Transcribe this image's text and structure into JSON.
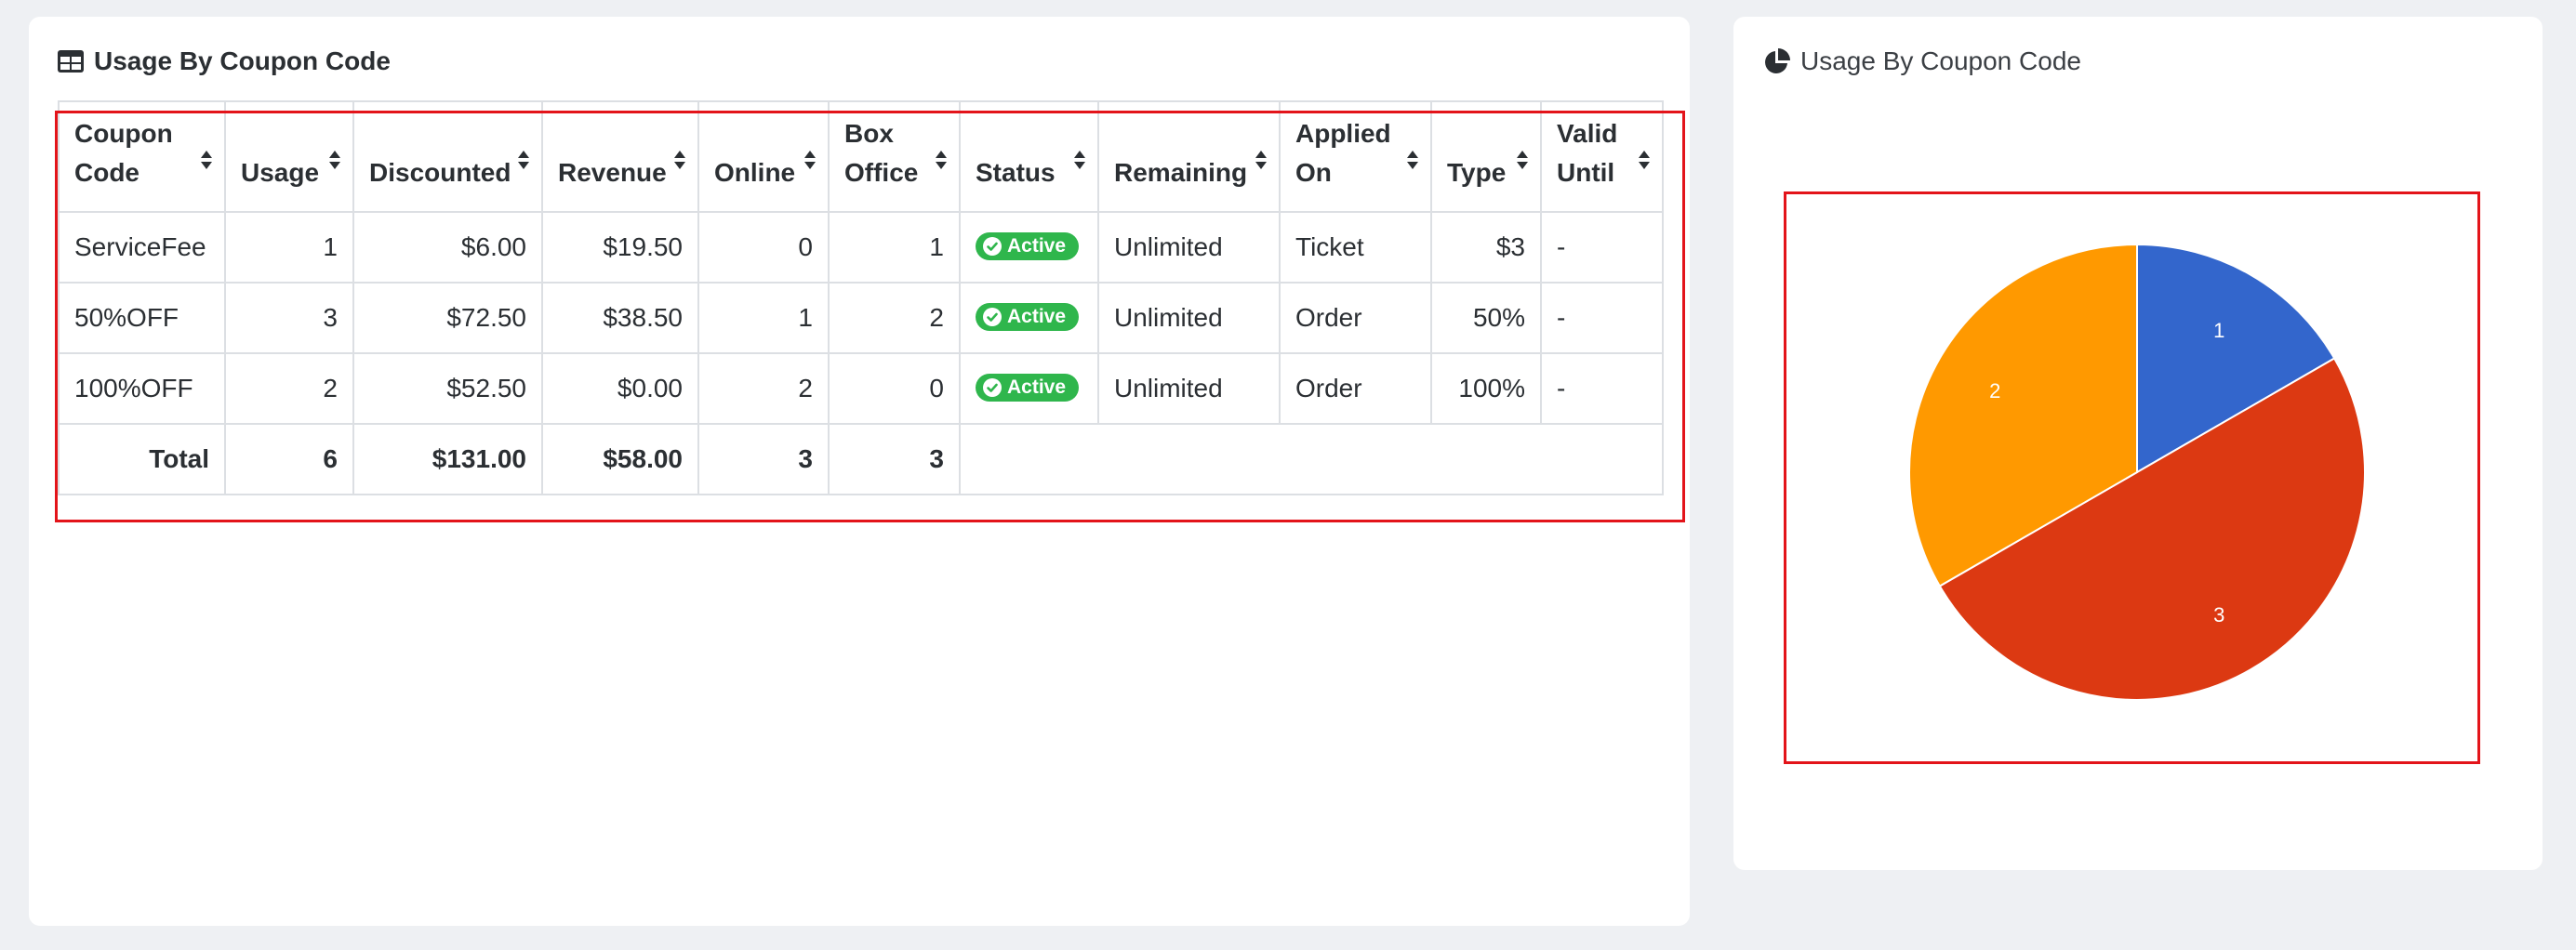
{
  "table_card": {
    "title": "Usage By Coupon Code",
    "icon": "table-icon",
    "columns": [
      "Coupon Code",
      "Usage",
      "Discounted",
      "Revenue",
      "Online",
      "Box Office",
      "Status",
      "Remaining",
      "Applied On",
      "Type",
      "Valid Until"
    ],
    "rows": [
      {
        "code": "ServiceFee",
        "usage": "1",
        "discounted": "$6.00",
        "revenue": "$19.50",
        "online": "0",
        "box_office": "1",
        "status": "Active",
        "remaining": "Unlimited",
        "applied_on": "Ticket",
        "type": "$3",
        "valid_until": "-"
      },
      {
        "code": "50%OFF",
        "usage": "3",
        "discounted": "$72.50",
        "revenue": "$38.50",
        "online": "1",
        "box_office": "2",
        "status": "Active",
        "remaining": "Unlimited",
        "applied_on": "Order",
        "type": "50%",
        "valid_until": "-"
      },
      {
        "code": "100%OFF",
        "usage": "2",
        "discounted": "$52.50",
        "revenue": "$0.00",
        "online": "2",
        "box_office": "0",
        "status": "Active",
        "remaining": "Unlimited",
        "applied_on": "Order",
        "type": "100%",
        "valid_until": "-"
      }
    ],
    "totals": {
      "label": "Total",
      "usage": "6",
      "discounted": "$131.00",
      "revenue": "$58.00",
      "online": "3",
      "box_office": "3"
    }
  },
  "chart_card": {
    "title": "Usage By Coupon Code",
    "icon": "pie-chart-icon"
  },
  "chart_data": {
    "type": "pie",
    "categories": [
      "ServiceFee",
      "50%OFF",
      "100%OFF"
    ],
    "values": [
      1,
      3,
      2
    ],
    "slice_labels": [
      "1",
      "3",
      "2"
    ],
    "colors": [
      "#3366cc",
      "#dc3912",
      "#ff9900"
    ],
    "title": "",
    "legend": "none"
  },
  "colors": {
    "active_badge": "#2fb64c",
    "highlight_outline": "#e3141a"
  }
}
